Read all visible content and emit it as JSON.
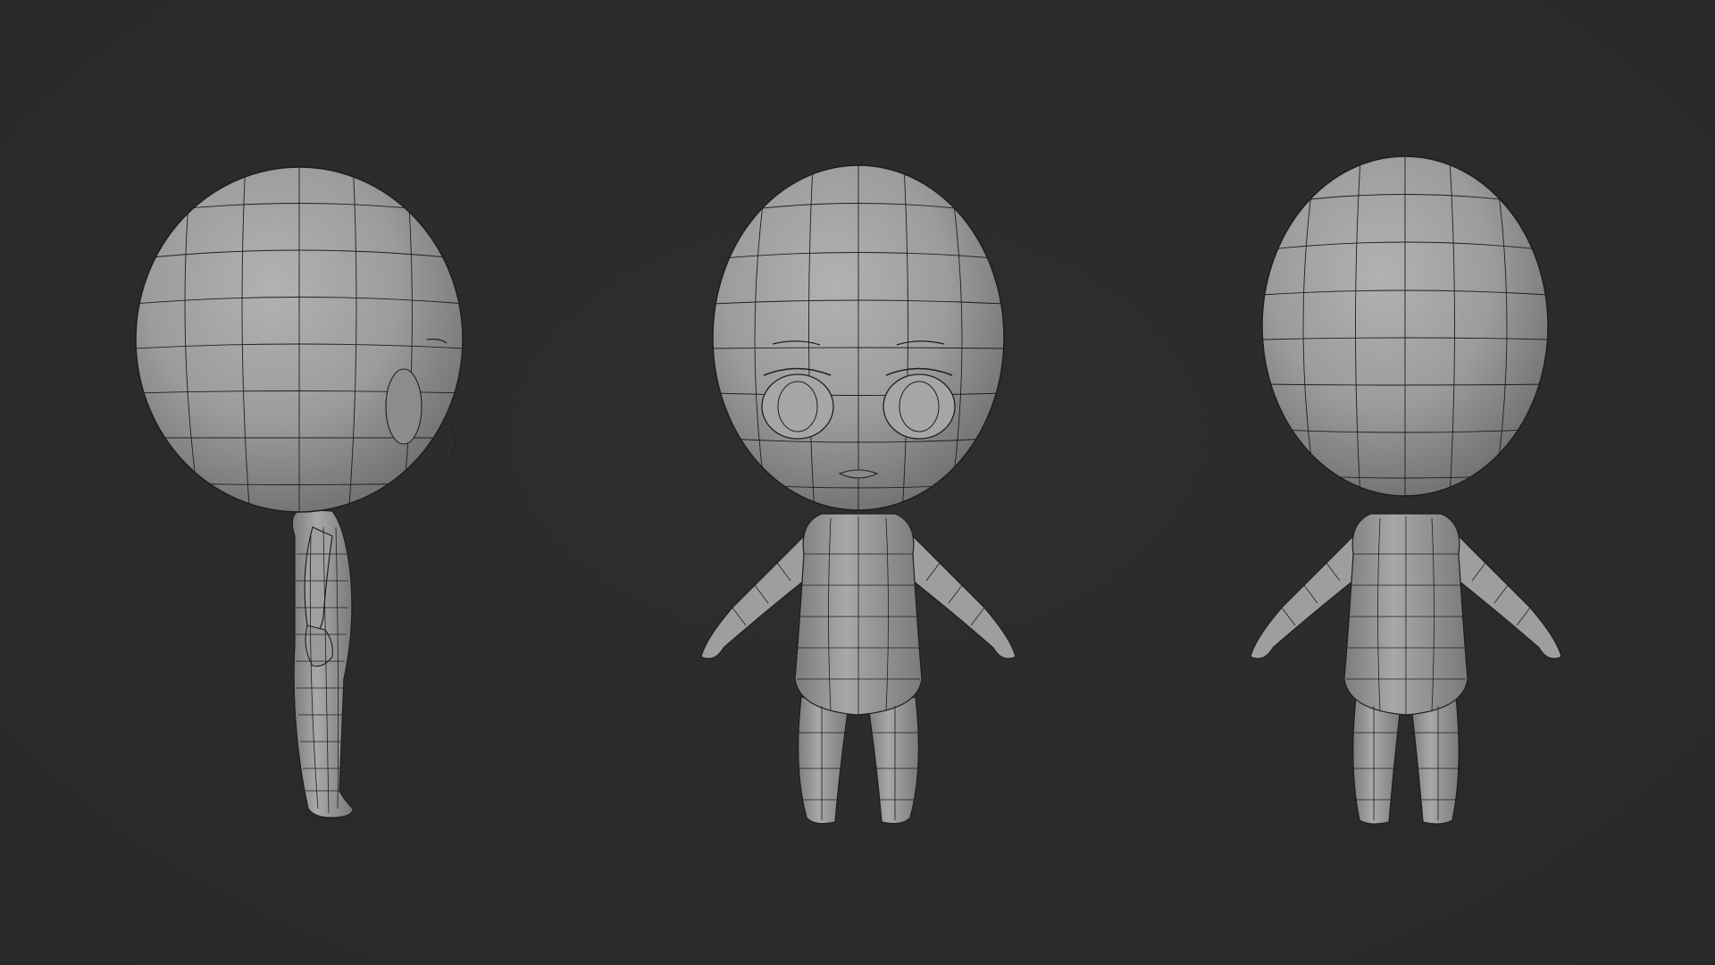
{
  "scene": {
    "background_color": "#2b2b2b",
    "mesh_color": "#9a9a9a",
    "wire_color": "#1e1e1e",
    "views": [
      {
        "name": "side",
        "icon": "character-side-view"
      },
      {
        "name": "front",
        "icon": "character-front-view"
      },
      {
        "name": "back",
        "icon": "character-back-view"
      }
    ]
  }
}
